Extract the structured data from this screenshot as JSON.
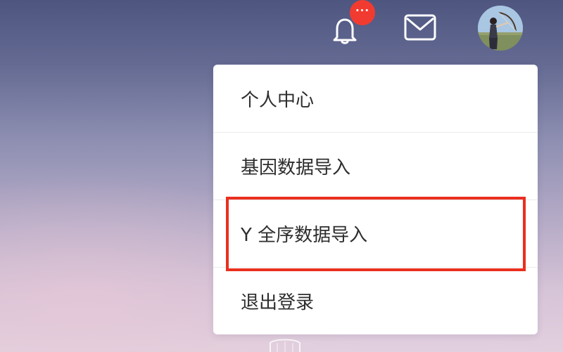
{
  "header": {
    "notification": {
      "icon": "bell-icon",
      "badge_text": "···",
      "badge_color": "#f23b30"
    },
    "mail": {
      "icon": "mail-icon"
    },
    "avatar": {
      "icon": "user-avatar"
    }
  },
  "dropdown": {
    "items": [
      {
        "label": "个人中心"
      },
      {
        "label": "基因数据导入"
      },
      {
        "label": "Y 全序数据导入",
        "highlighted": true
      },
      {
        "label": "退出登录"
      }
    ]
  },
  "colors": {
    "highlight_border": "#ea2f1f",
    "menu_text": "#2d2d2d",
    "menu_bg": "#ffffff"
  }
}
